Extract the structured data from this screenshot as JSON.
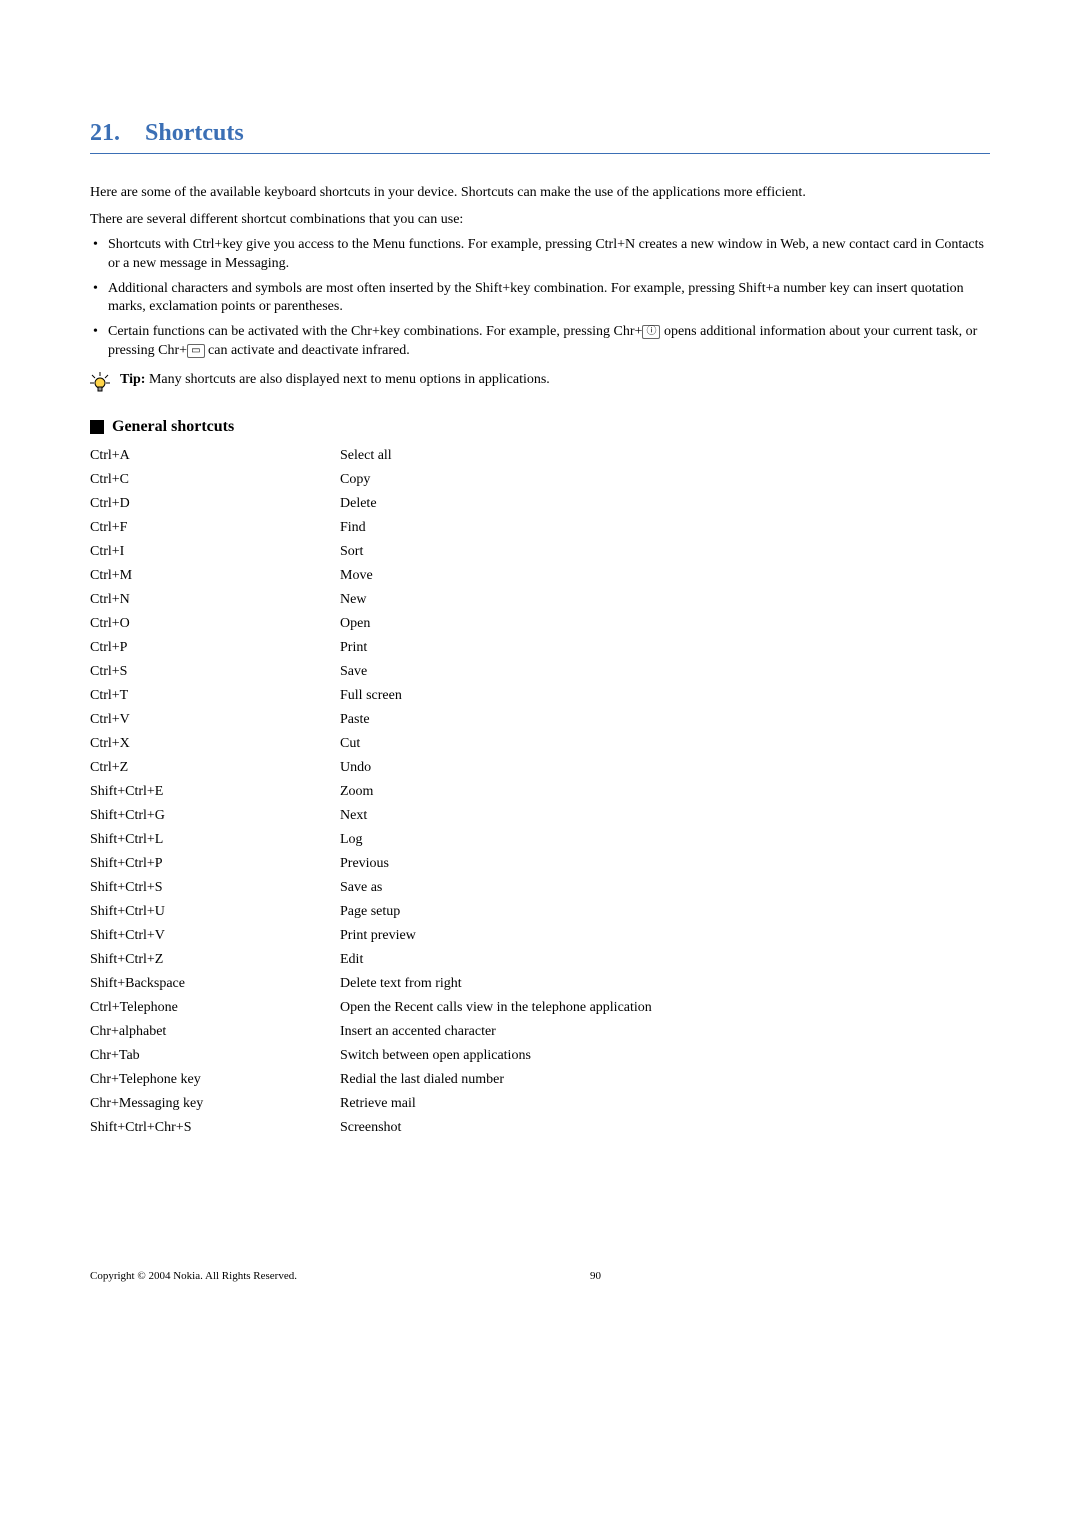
{
  "chapter": {
    "num": "21.",
    "title": "Shortcuts"
  },
  "intro": "Here are some of the available keyboard shortcuts in your device. Shortcuts can make the use of the applications more efficient.",
  "sub_intro": "There are several different shortcut combinations that you can use:",
  "bullets": [
    "Shortcuts with Ctrl+key give you access to the Menu functions. For example, pressing Ctrl+N creates a new window in Web, a new contact card in Contacts or a new message in Messaging.",
    "Additional characters and symbols are most often inserted by the Shift+key combination. For example, pressing Shift+a number key can insert quotation marks, exclamation points or parentheses."
  ],
  "bullet3": {
    "before": "Certain functions can be activated with the Chr+key combinations. For example, pressing Chr+",
    "icon1": "ⓘ",
    "mid": " opens additional information about your current task, or pressing Chr+",
    "icon2": "▭",
    "after": " can activate and deactivate infrared."
  },
  "tip": {
    "label": "Tip: ",
    "text": "Many shortcuts are also displayed next to menu options in applications."
  },
  "section": {
    "title": "General shortcuts"
  },
  "rows": [
    {
      "key": "Ctrl+A",
      "action": "Select all"
    },
    {
      "key": "Ctrl+C",
      "action": "Copy"
    },
    {
      "key": "Ctrl+D",
      "action": "Delete"
    },
    {
      "key": "Ctrl+F",
      "action": "Find"
    },
    {
      "key": "Ctrl+I",
      "action": "Sort"
    },
    {
      "key": "Ctrl+M",
      "action": "Move"
    },
    {
      "key": "Ctrl+N",
      "action": "New"
    },
    {
      "key": "Ctrl+O",
      "action": "Open"
    },
    {
      "key": "Ctrl+P",
      "action": "Print"
    },
    {
      "key": "Ctrl+S",
      "action": "Save"
    },
    {
      "key": "Ctrl+T",
      "action": "Full screen"
    },
    {
      "key": "Ctrl+V",
      "action": "Paste"
    },
    {
      "key": "Ctrl+X",
      "action": "Cut"
    },
    {
      "key": "Ctrl+Z",
      "action": "Undo"
    },
    {
      "key": "Shift+Ctrl+E",
      "action": "Zoom"
    },
    {
      "key": "Shift+Ctrl+G",
      "action": "Next"
    },
    {
      "key": "Shift+Ctrl+L",
      "action": "Log"
    },
    {
      "key": "Shift+Ctrl+P",
      "action": "Previous"
    },
    {
      "key": "Shift+Ctrl+S",
      "action": "Save as"
    },
    {
      "key": "Shift+Ctrl+U",
      "action": "Page setup"
    },
    {
      "key": "Shift+Ctrl+V",
      "action": "Print preview"
    },
    {
      "key": "Shift+Ctrl+Z",
      "action": "Edit"
    },
    {
      "key": "Shift+Backspace",
      "action": "Delete text from right"
    },
    {
      "key": "Ctrl+Telephone",
      "action": "Open the Recent calls view in the telephone application"
    },
    {
      "key": "Chr+alphabet",
      "action": "Insert an accented character"
    },
    {
      "key": "Chr+Tab",
      "action": "Switch between open applications"
    },
    {
      "key": "Chr+Telephone key",
      "action": "Redial the last dialed number"
    },
    {
      "key": "Chr+Messaging key",
      "action": "Retrieve mail"
    },
    {
      "key": "Shift+Ctrl+Chr+S",
      "action": "Screenshot"
    }
  ],
  "footer": {
    "copyright": "Copyright © 2004 Nokia. All Rights Reserved.",
    "page": "90"
  }
}
